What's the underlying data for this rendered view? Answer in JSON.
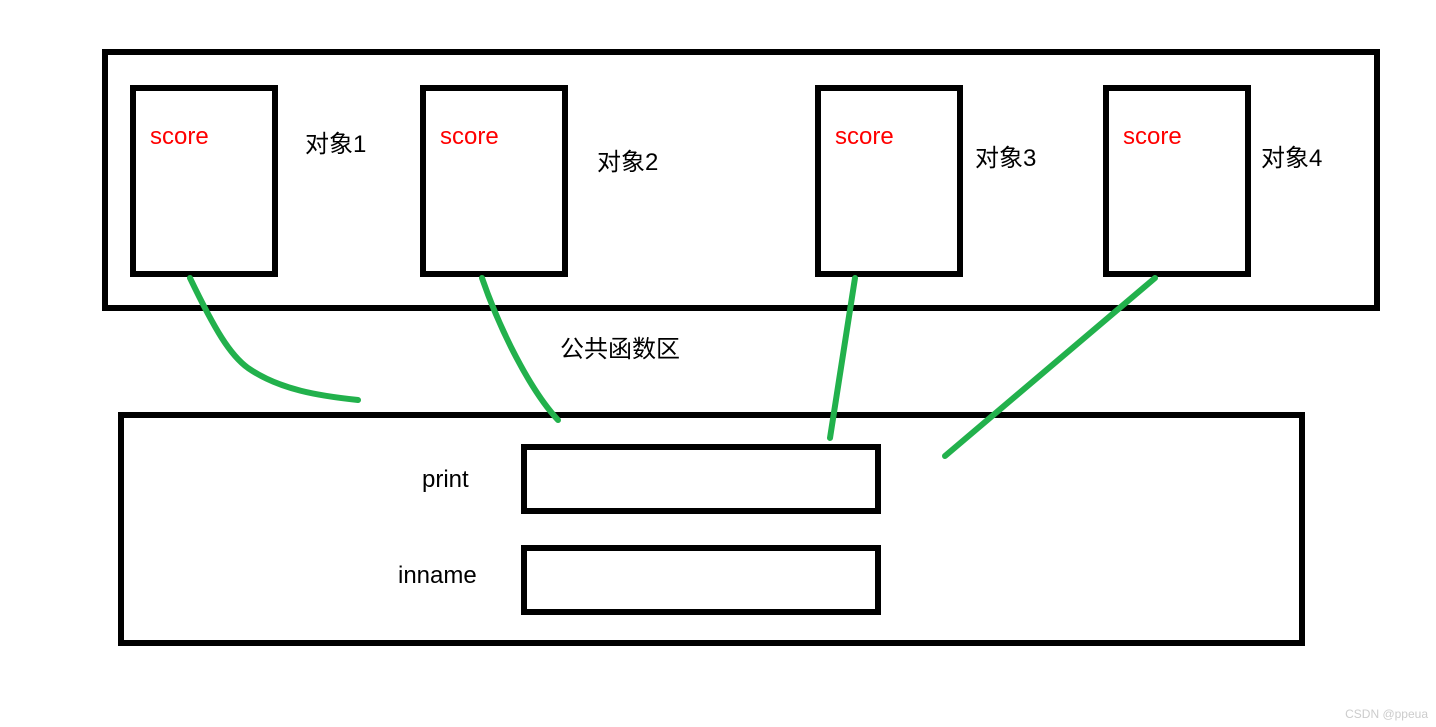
{
  "objects": [
    {
      "field": "score",
      "label": "对象1"
    },
    {
      "field": "score",
      "label": "对象2"
    },
    {
      "field": "score",
      "label": "对象3"
    },
    {
      "field": "score",
      "label": "对象4"
    }
  ],
  "section_label": "公共函数区",
  "functions": [
    {
      "name": "print"
    },
    {
      "name": "inname"
    }
  ],
  "watermark": "CSDN @ppeua"
}
